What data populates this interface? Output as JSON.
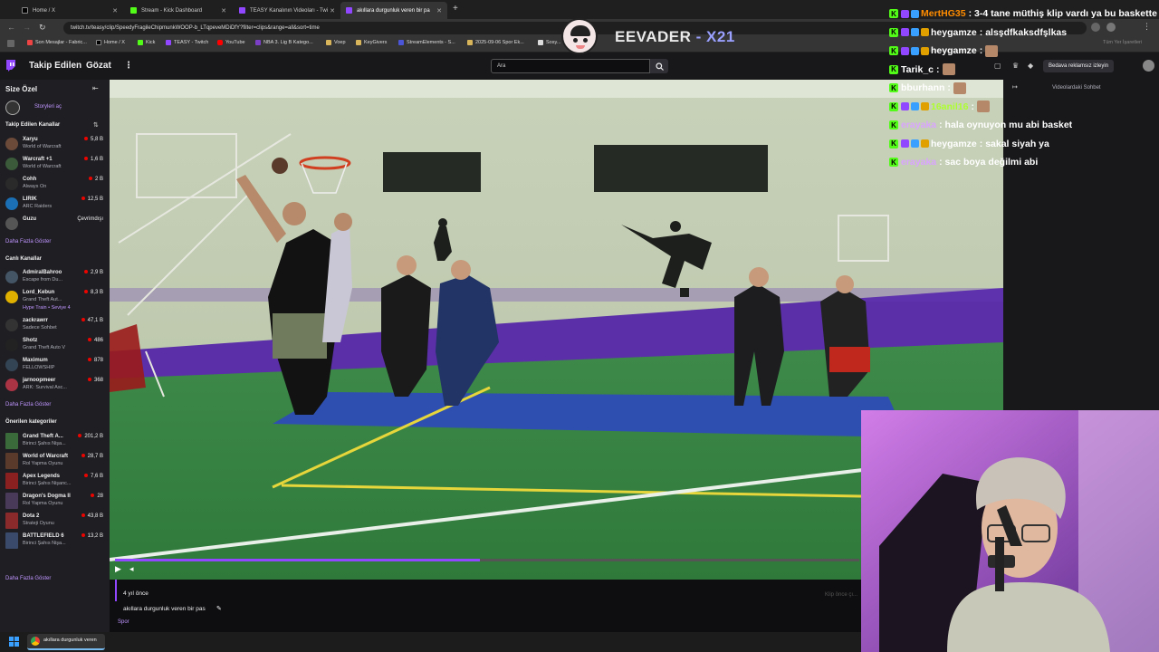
{
  "browser": {
    "tabs": [
      {
        "label": "Home / X",
        "color": "#000000"
      },
      {
        "label": "Stream - Kick Dashboard",
        "color": "#53fc18"
      },
      {
        "label": "TEASY Kanalının Videoları - Twi",
        "color": "#9146ff"
      },
      {
        "label": "akıllara durgunluk veren bir pa",
        "color": "#9146ff"
      }
    ],
    "new_tab": "+",
    "url": "twitch.tv/teasy/clip/SpeedyFragileChipmunkWOOP-b_LTqpeveMDiDfY?filter=clips&range=all&sort=time",
    "bookmarks": [
      "Son Mesajlar - Fabric...",
      "Home / X",
      "Kick",
      "TEASY - Twitch",
      "YouTube",
      "NBA 3. Lig B Katego...",
      "Voep",
      "KeyGivers",
      "StreamElements - S...",
      "2025-09-06 Spor Ek...",
      "Sosy..."
    ],
    "bookmarks_right": "Tüm Yer İşaretleri"
  },
  "overlay": {
    "streamer": "EEVADER",
    "tag": "- X21"
  },
  "chat": [
    {
      "user": "MertHG35",
      "user_color": "#ff8c00",
      "msg": ": 3-4 tane müthiş klip vardı ya bu baskette",
      "badges": 2
    },
    {
      "user": "heygamze",
      "user_color": "#ffffff",
      "msg": ": alsşdfkaksdfşlkas",
      "badges": 3
    },
    {
      "user": "heygamze",
      "user_color": "#ffffff",
      "msg": ":",
      "badges": 3,
      "emote": true
    },
    {
      "user": "Tarik_c",
      "user_color": "#ffffff",
      "msg": ":",
      "badges": 0,
      "emote": true
    },
    {
      "user": "bburhann",
      "user_color": "#ffffff",
      "msg": ":",
      "badges": 0,
      "emote": true
    },
    {
      "user": "16anil16",
      "user_color": "#adff2f",
      "msg": ":",
      "badges": 3,
      "emote": true
    },
    {
      "user": "erayaka",
      "user_color": "#d9a3ff",
      "msg": ": hala oynuyon mu abi basket",
      "badges": 0
    },
    {
      "user": "heygamze",
      "user_color": "#ffffff",
      "msg": ": sakal siyah ya",
      "badges": 3
    },
    {
      "user": "erayaka",
      "user_color": "#d9a3ff",
      "msg": ": sac boya değilmi abi",
      "badges": 0
    }
  ],
  "twitch": {
    "nav": {
      "following": "Takip Edilen",
      "browse": "Gözat"
    },
    "search_placeholder": "Ara",
    "right_nav": {
      "ad_free": "Bedava reklamsız izleyin"
    },
    "side_panel_title": "Videolardaki Sohbet",
    "sidebar": {
      "for_you": "Size Özel",
      "stories": "Storyleri aç",
      "followed_header": "Takip Edilen Kanallar",
      "followed": [
        {
          "name": "Xaryu",
          "game": "World of Warcraft",
          "count": "5,8 B",
          "color": "#6b4a3a"
        },
        {
          "name": "Warcraft +1",
          "game": "World of Warcraft",
          "count": "1,6 B",
          "color": "#3a5a3a"
        },
        {
          "name": "Cohh",
          "game": "Always On",
          "count": "2 B",
          "color": "#2a2a2a"
        },
        {
          "name": "LIRIK",
          "game": "ARC Raiders",
          "count": "12,5 B",
          "color": "#1a6fb5"
        },
        {
          "name": "Guzu",
          "game": "",
          "count": "Çevrimdışı",
          "color": "#555555"
        }
      ],
      "show_more": "Daha Fazla Göster",
      "live_header": "Canlı Kanallar",
      "live": [
        {
          "name": "AdmiralBahroo",
          "game": "Escape from Du...",
          "count": "2,9 B",
          "color": "#445566"
        },
        {
          "name": "Lord_Kebun",
          "game": "Grand Theft Aut...",
          "count": "8,3 B",
          "color": "#e0b000",
          "extra": "Hype Train • Seviye 4"
        },
        {
          "name": "zackrawrr",
          "game": "Sadece Sohbet",
          "count": "47,1 B",
          "color": "#333333"
        },
        {
          "name": "Shotz",
          "game": "Grand Theft Auto V",
          "count": "486",
          "color": "#222222"
        },
        {
          "name": "Maximum",
          "game": "FELLOWSHIP",
          "count": "878",
          "color": "#334455"
        },
        {
          "name": "jarnoopmeer",
          "game": "ARK: Survival Asc...",
          "count": "368",
          "color": "#aa3344"
        }
      ],
      "categories_header": "Önerilen kategoriler",
      "categories": [
        {
          "name": "Grand Theft A...",
          "genre": "Birinci Şahıs Nişa...",
          "count": "201,2 B",
          "color": "#3a6a3a"
        },
        {
          "name": "World of Warcraft",
          "genre": "Rol Yapma Oyunu",
          "count": "28,7 B",
          "color": "#5a3a2a"
        },
        {
          "name": "Apex Legends",
          "genre": "Birinci Şahıs Nişanc...",
          "count": "7,6 B",
          "color": "#8a2020"
        },
        {
          "name": "Dragon's Dogma II",
          "genre": "Rol Yapma Oyunu",
          "count": "28",
          "color": "#4a3a5a"
        },
        {
          "name": "Dota 2",
          "genre": "Strateji Oyunu",
          "count": "43,8 B",
          "color": "#8a2a2a"
        },
        {
          "name": "BATTLEFIELD 6",
          "genre": "Birinci Şahıs Nişa...",
          "count": "13,2 B",
          "color": "#3a4a6a"
        }
      ]
    },
    "clip": {
      "age": "4 yıl önce",
      "title": "akıllara durgunluk veren bir pas",
      "category": "Spor",
      "clip_button": "Klip önce çı..."
    },
    "player": {
      "progress": 0.49
    }
  },
  "taskbar": {
    "app_label": "akıllara durgunluk veren"
  }
}
